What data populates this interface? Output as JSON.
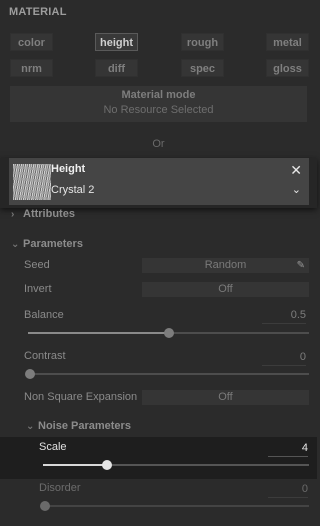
{
  "header": {
    "title": "MATERIAL"
  },
  "channels": {
    "row1": [
      "color",
      "height",
      "rough",
      "metal"
    ],
    "row2": [
      "nrm",
      "diff",
      "spec",
      "gloss"
    ],
    "selected": "height"
  },
  "material_mode": {
    "title": "Material mode",
    "subtitle": "No Resource Selected"
  },
  "or_label": "Or",
  "resource": {
    "title": "Height",
    "name": "Crystal 2"
  },
  "sections": {
    "attributes": "Attributes",
    "parameters": "Parameters",
    "noise": "Noise Parameters"
  },
  "params": {
    "seed": {
      "label": "Seed",
      "value": "Random"
    },
    "invert": {
      "label": "Invert",
      "value": "Off"
    },
    "balance": {
      "label": "Balance",
      "value": "0.5",
      "fraction": 0.5
    },
    "contrast": {
      "label": "Contrast",
      "value": "0",
      "fraction": 0.0
    },
    "nonsquare": {
      "label": "Non Square Expansion",
      "value": "Off"
    },
    "scale": {
      "label": "Scale",
      "value": "4",
      "fraction": 0.24
    },
    "disorder": {
      "label": "Disorder",
      "value": "0",
      "fraction": 0.0
    }
  },
  "icons": {
    "close": "close-icon",
    "chevron": "chevron-down-icon",
    "edit": "pencil-icon"
  }
}
